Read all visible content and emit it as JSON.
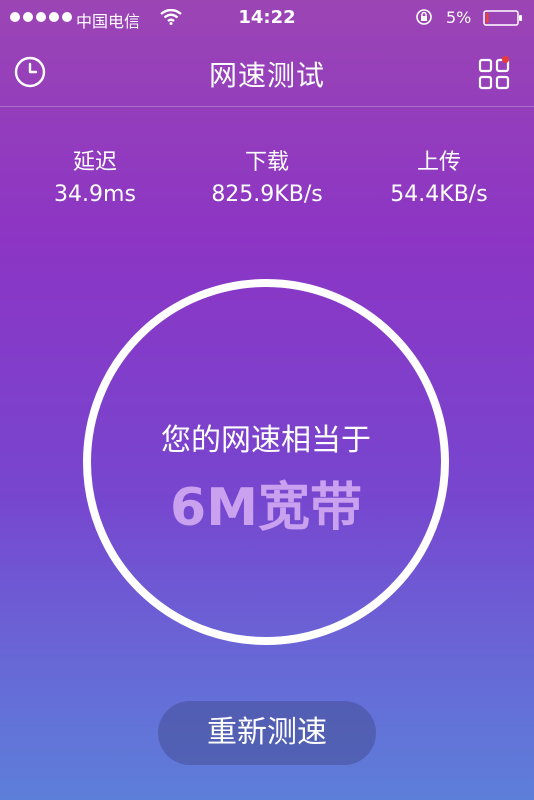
{
  "status_bar": {
    "carrier": "中国电信",
    "time": "14:22",
    "battery_percent": "5%"
  },
  "header": {
    "title": "网速测试",
    "history_icon": "clock-icon",
    "apps_icon": "grid-apps-icon",
    "badge_color": "#e83a3a"
  },
  "stats": {
    "latency": {
      "label": "延迟",
      "value": "34.9ms"
    },
    "download": {
      "label": "下载",
      "value": "825.9KB/s"
    },
    "upload": {
      "label": "上传",
      "value": "54.4KB/s"
    }
  },
  "result": {
    "caption": "您的网速相当于",
    "value": "6M宽带",
    "highlight_color": "#c9a1ee"
  },
  "retest_button": {
    "label": "重新测速"
  }
}
